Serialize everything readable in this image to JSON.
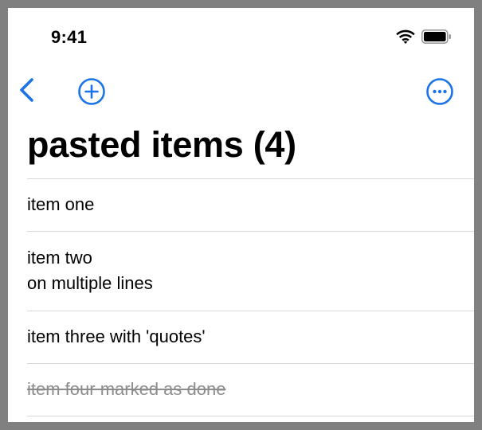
{
  "status_bar": {
    "time": "9:41",
    "icons": [
      "wifi-icon",
      "battery-icon"
    ]
  },
  "nav": {
    "back_icon": "chevron-left-icon",
    "add_icon": "plus-circle-icon",
    "more_icon": "ellipsis-circle-icon"
  },
  "page": {
    "title": "pasted items (4)"
  },
  "items": [
    {
      "text": "item one",
      "done": false
    },
    {
      "text": "item two\non multiple lines",
      "done": false
    },
    {
      "text": "item three with 'quotes'",
      "done": false
    },
    {
      "text": "item four marked as done",
      "done": true
    }
  ],
  "colors": {
    "accent": "#1a73e8",
    "done_text": "#8c8c8c",
    "separator": "#d9d9d9"
  }
}
